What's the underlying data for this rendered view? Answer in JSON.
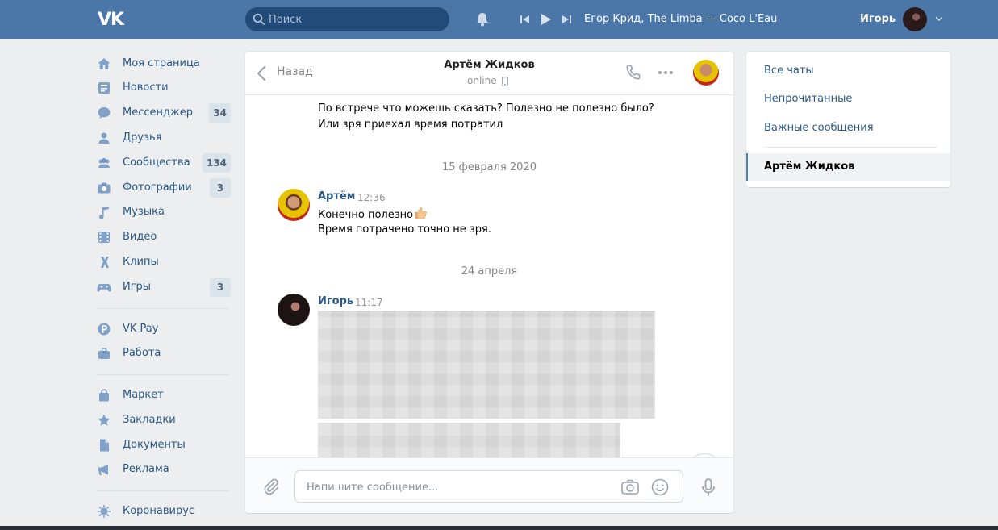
{
  "header": {
    "logo": "VK",
    "search_placeholder": "Поиск",
    "track": "Егор Крид, The Limba — Coco L'Eau",
    "user_name": "Игорь"
  },
  "nav": {
    "items": [
      {
        "label": "Моя страница",
        "icon": "home-icon"
      },
      {
        "label": "Новости",
        "icon": "news-icon"
      },
      {
        "label": "Мессенджер",
        "icon": "messenger-icon",
        "count": "34"
      },
      {
        "label": "Друзья",
        "icon": "friends-icon"
      },
      {
        "label": "Сообщества",
        "icon": "communities-icon",
        "count": "134"
      },
      {
        "label": "Фотографии",
        "icon": "camera-icon",
        "count": "3"
      },
      {
        "label": "Музыка",
        "icon": "music-icon"
      },
      {
        "label": "Видео",
        "icon": "video-icon"
      },
      {
        "label": "Клипы",
        "icon": "clips-icon"
      },
      {
        "label": "Игры",
        "icon": "gamepad-icon",
        "count": "3"
      },
      {
        "label": "VK Pay",
        "icon": "vkpay-icon"
      },
      {
        "label": "Работа",
        "icon": "briefcase-icon"
      },
      {
        "label": "Маркет",
        "icon": "market-bag-icon"
      },
      {
        "label": "Закладки",
        "icon": "star-icon"
      },
      {
        "label": "Документы",
        "icon": "document-icon"
      },
      {
        "label": "Реклама",
        "icon": "megaphone-icon"
      },
      {
        "label": "Коронавирус",
        "icon": "virus-icon"
      }
    ]
  },
  "chat": {
    "back_label": "Назад",
    "peer_name": "Артём Жидков",
    "peer_status": "online",
    "messages_top": [
      "По встрече что можешь сказать? Полезно не полезно было?",
      "Или зря приехал время потратил"
    ],
    "date1": "15 февраля 2020",
    "msg1": {
      "author": "Артём",
      "time": "12:36",
      "lines": [
        "Конечно полезно",
        "Время потрачено точно не зря."
      ]
    },
    "date2": "24 апреля",
    "msg2": {
      "author": "Игорь",
      "time": "11:17"
    },
    "composer_placeholder": "Напишите сообщение..."
  },
  "right_panel": {
    "items": [
      "Все чаты",
      "Непрочитанные",
      "Важные сообщения"
    ],
    "active": "Артём Жидков"
  },
  "colors": {
    "header": "#4a76a8",
    "link": "#2a5885",
    "background": "#edeef0"
  }
}
